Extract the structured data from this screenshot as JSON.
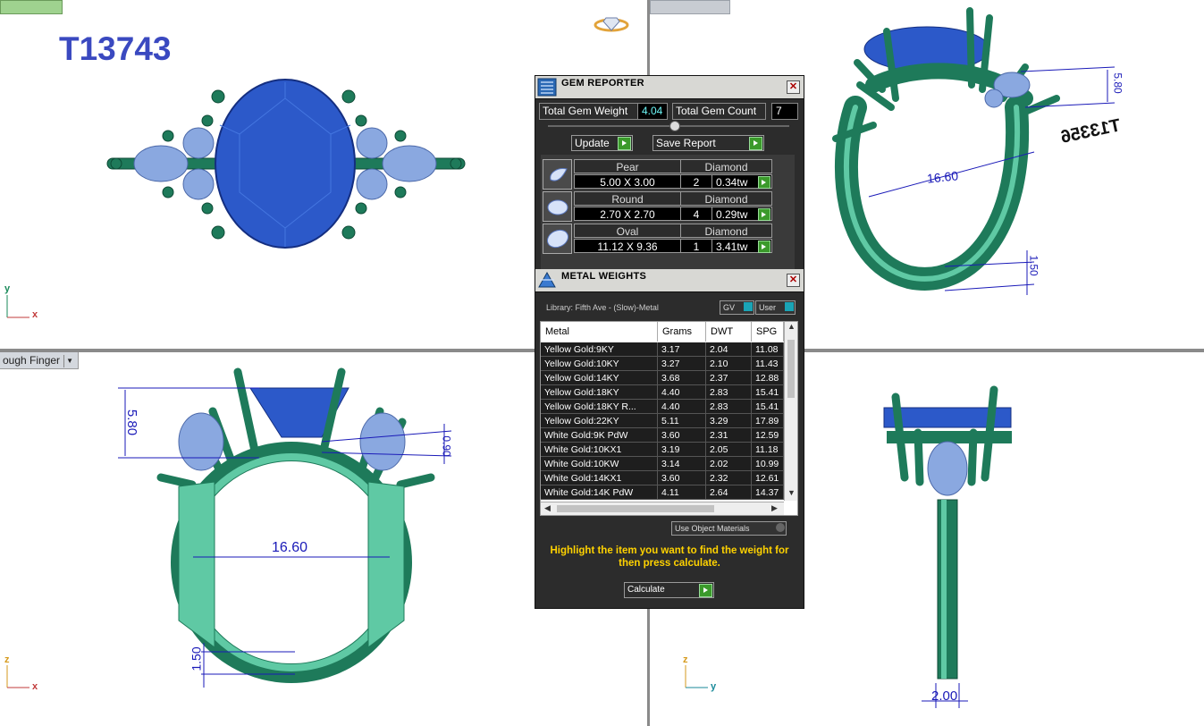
{
  "viewports": {
    "top_left": {
      "ring_id": "T13743",
      "axis_v": "y",
      "axis_h": "x"
    },
    "top_right": {
      "dim_a": "5.80",
      "dim_b": "16.60",
      "dim_c": "1.50",
      "mirror_text": "T13356"
    },
    "bottom_left": {
      "view_name": "ough Finger",
      "dim_a": "5.80",
      "dim_b": "0.90",
      "dim_c": "16.60",
      "dim_d": "1.50",
      "axis_v": "z",
      "axis_h": "x"
    },
    "bottom_right": {
      "dim_a": "2.00",
      "axis_v": "z",
      "axis_h": "y"
    }
  },
  "colors": {
    "metal_green": "#1f7a5a",
    "metal_light": "#5fc9a4",
    "sapphire": "#2c59c9",
    "diamond": "#8aa8e0",
    "dimension_blue": "#1a1ab8"
  },
  "gem_reporter": {
    "title": "GEM REPORTER",
    "total_weight_label": "Total Gem Weight",
    "total_weight_value": "4.04",
    "total_count_label": "Total Gem Count",
    "total_count_value": "7",
    "update_label": "Update",
    "save_label": "Save Report",
    "gems": [
      {
        "shape": "Pear",
        "size": "5.00 X 3.00",
        "material": "Diamond",
        "count": "2",
        "weight": "0.34tw"
      },
      {
        "shape": "Round",
        "size": "2.70 X 2.70",
        "material": "Diamond",
        "count": "4",
        "weight": "0.29tw"
      },
      {
        "shape": "Oval",
        "size": "11.12 X 9.36",
        "material": "Diamond",
        "count": "1",
        "weight": "3.41tw"
      }
    ]
  },
  "metal_weights": {
    "title": "METAL WEIGHTS",
    "library": "Library: Fifth Ave - (Slow)-Metal",
    "gv_label": "GV",
    "user_label": "User",
    "columns": [
      "Metal",
      "Grams",
      "DWT",
      "SPG"
    ],
    "rows": [
      [
        "Yellow Gold:9KY",
        "3.17",
        "2.04",
        "11.08"
      ],
      [
        "Yellow Gold:10KY",
        "3.27",
        "2.10",
        "11.43"
      ],
      [
        "Yellow Gold:14KY",
        "3.68",
        "2.37",
        "12.88"
      ],
      [
        "Yellow Gold:18KY",
        "4.40",
        "2.83",
        "15.41"
      ],
      [
        "Yellow Gold:18KY R...",
        "4.40",
        "2.83",
        "15.41"
      ],
      [
        "Yellow Gold:22KY",
        "5.11",
        "3.29",
        "17.89"
      ],
      [
        "White Gold:9K PdW",
        "3.60",
        "2.31",
        "12.59"
      ],
      [
        "White Gold:10KX1",
        "3.19",
        "2.05",
        "11.18"
      ],
      [
        "White Gold:10KW",
        "3.14",
        "2.02",
        "10.99"
      ],
      [
        "White Gold:14KX1",
        "3.60",
        "2.32",
        "12.61"
      ],
      [
        "White Gold:14K PdW",
        "4.11",
        "2.64",
        "14.37"
      ]
    ],
    "use_object_materials": "Use Object Materials",
    "hint": "Highlight the item you want to find the weight for then press calculate.",
    "calculate_label": "Calculate"
  }
}
